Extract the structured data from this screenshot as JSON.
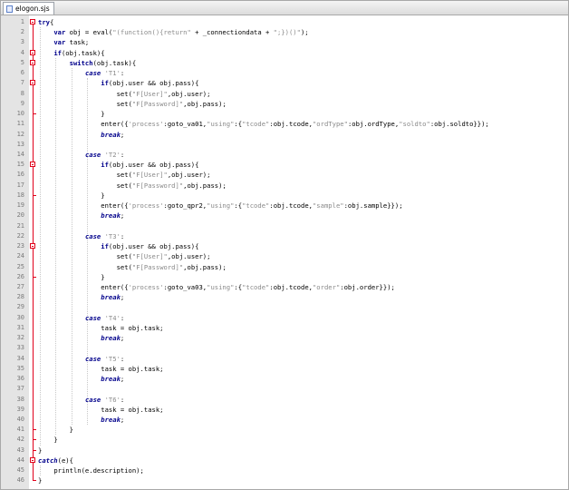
{
  "tab": {
    "title": "elogon.sjs",
    "icon": "document-icon"
  },
  "colors": {
    "fold_marker": "#e0001a",
    "keyword": "#00008b",
    "string": "#8a8a8a",
    "gutter_bg": "#e4e4e4",
    "line_number": "#7a7a7a"
  },
  "code_lines": [
    {
      "n": "1",
      "indent": 0,
      "fold": "start",
      "tokens": [
        {
          "t": "try",
          "c": "kw"
        },
        {
          "t": "{",
          "c": "txt"
        }
      ]
    },
    {
      "n": "2",
      "indent": 2,
      "fold": "",
      "tokens": [
        {
          "t": "var",
          "c": "kw"
        },
        {
          "t": " obj = eval(",
          "c": "txt"
        },
        {
          "t": "\"(function(){return\"",
          "c": "str"
        },
        {
          "t": " + _connectiondata + ",
          "c": "txt"
        },
        {
          "t": "\";})()\"",
          "c": "str"
        },
        {
          "t": ");",
          "c": "txt"
        }
      ]
    },
    {
      "n": "3",
      "indent": 2,
      "fold": "",
      "tokens": [
        {
          "t": "var",
          "c": "kw"
        },
        {
          "t": " task;",
          "c": "txt"
        }
      ]
    },
    {
      "n": "4",
      "indent": 2,
      "fold": "start",
      "tokens": [
        {
          "t": "if",
          "c": "kw"
        },
        {
          "t": "(obj.task){",
          "c": "txt"
        }
      ]
    },
    {
      "n": "5",
      "indent": 4,
      "fold": "start",
      "tokens": [
        {
          "t": "switch",
          "c": "kw"
        },
        {
          "t": "(obj.task){",
          "c": "txt"
        }
      ]
    },
    {
      "n": "6",
      "indent": 6,
      "fold": "",
      "tokens": [
        {
          "t": "case",
          "c": "kwi"
        },
        {
          "t": " ",
          "c": "txt"
        },
        {
          "t": "'T1'",
          "c": "str"
        },
        {
          "t": ":",
          "c": "txt"
        }
      ]
    },
    {
      "n": "7",
      "indent": 8,
      "fold": "start",
      "tokens": [
        {
          "t": "if",
          "c": "kw"
        },
        {
          "t": "(obj.user && obj.pass){",
          "c": "txt"
        }
      ]
    },
    {
      "n": "8",
      "indent": 10,
      "fold": "",
      "tokens": [
        {
          "t": "set(",
          "c": "txt"
        },
        {
          "t": "\"F[User]\"",
          "c": "str"
        },
        {
          "t": ",obj.user);",
          "c": "txt"
        }
      ]
    },
    {
      "n": "9",
      "indent": 10,
      "fold": "",
      "tokens": [
        {
          "t": "set(",
          "c": "txt"
        },
        {
          "t": "\"F[Password]\"",
          "c": "str"
        },
        {
          "t": ",obj.pass);",
          "c": "txt"
        }
      ]
    },
    {
      "n": "10",
      "indent": 8,
      "fold": "end",
      "tokens": [
        {
          "t": "}",
          "c": "txt"
        }
      ]
    },
    {
      "n": "11",
      "indent": 8,
      "fold": "",
      "tokens": [
        {
          "t": "enter({",
          "c": "txt"
        },
        {
          "t": "'process'",
          "c": "str"
        },
        {
          "t": ":goto_va01,",
          "c": "txt"
        },
        {
          "t": "\"using\"",
          "c": "str"
        },
        {
          "t": ":{",
          "c": "txt"
        },
        {
          "t": "\"tcode\"",
          "c": "str"
        },
        {
          "t": ":obj.tcode,",
          "c": "txt"
        },
        {
          "t": "\"ordType\"",
          "c": "str"
        },
        {
          "t": ":obj.ordType,",
          "c": "txt"
        },
        {
          "t": "\"soldto\"",
          "c": "str"
        },
        {
          "t": ":obj.soldto}});",
          "c": "txt"
        }
      ]
    },
    {
      "n": "12",
      "indent": 8,
      "fold": "",
      "tokens": [
        {
          "t": "break",
          "c": "kwi"
        },
        {
          "t": ";",
          "c": "txt"
        }
      ]
    },
    {
      "n": "13",
      "indent": 0,
      "fold": "",
      "tokens": []
    },
    {
      "n": "14",
      "indent": 6,
      "fold": "",
      "tokens": [
        {
          "t": "case",
          "c": "kwi"
        },
        {
          "t": " ",
          "c": "txt"
        },
        {
          "t": "'T2'",
          "c": "str"
        },
        {
          "t": ":",
          "c": "txt"
        }
      ]
    },
    {
      "n": "15",
      "indent": 8,
      "fold": "start",
      "tokens": [
        {
          "t": "if",
          "c": "kw"
        },
        {
          "t": "(obj.user && obj.pass){",
          "c": "txt"
        }
      ]
    },
    {
      "n": "16",
      "indent": 10,
      "fold": "",
      "tokens": [
        {
          "t": "set(",
          "c": "txt"
        },
        {
          "t": "\"F[User]\"",
          "c": "str"
        },
        {
          "t": ",obj.user);",
          "c": "txt"
        }
      ]
    },
    {
      "n": "17",
      "indent": 10,
      "fold": "",
      "tokens": [
        {
          "t": "set(",
          "c": "txt"
        },
        {
          "t": "\"F[Password]\"",
          "c": "str"
        },
        {
          "t": ",obj.pass);",
          "c": "txt"
        }
      ]
    },
    {
      "n": "18",
      "indent": 8,
      "fold": "end",
      "tokens": [
        {
          "t": "}",
          "c": "txt"
        }
      ]
    },
    {
      "n": "19",
      "indent": 8,
      "fold": "",
      "tokens": [
        {
          "t": "enter({",
          "c": "txt"
        },
        {
          "t": "'process'",
          "c": "str"
        },
        {
          "t": ":goto_qpr2,",
          "c": "txt"
        },
        {
          "t": "\"using\"",
          "c": "str"
        },
        {
          "t": ":{",
          "c": "txt"
        },
        {
          "t": "\"tcode\"",
          "c": "str"
        },
        {
          "t": ":obj.tcode,",
          "c": "txt"
        },
        {
          "t": "\"sample\"",
          "c": "str"
        },
        {
          "t": ":obj.sample}});",
          "c": "txt"
        }
      ]
    },
    {
      "n": "20",
      "indent": 8,
      "fold": "",
      "tokens": [
        {
          "t": "break",
          "c": "kwi"
        },
        {
          "t": ";",
          "c": "txt"
        }
      ]
    },
    {
      "n": "21",
      "indent": 0,
      "fold": "",
      "tokens": []
    },
    {
      "n": "22",
      "indent": 6,
      "fold": "",
      "tokens": [
        {
          "t": "case",
          "c": "kwi"
        },
        {
          "t": " ",
          "c": "txt"
        },
        {
          "t": "'T3'",
          "c": "str"
        },
        {
          "t": ":",
          "c": "txt"
        }
      ]
    },
    {
      "n": "23",
      "indent": 8,
      "fold": "start",
      "tokens": [
        {
          "t": "if",
          "c": "kw"
        },
        {
          "t": "(obj.user && obj.pass){",
          "c": "txt"
        }
      ]
    },
    {
      "n": "24",
      "indent": 10,
      "fold": "",
      "tokens": [
        {
          "t": "set(",
          "c": "txt"
        },
        {
          "t": "\"F[User]\"",
          "c": "str"
        },
        {
          "t": ",obj.user);",
          "c": "txt"
        }
      ]
    },
    {
      "n": "25",
      "indent": 10,
      "fold": "",
      "tokens": [
        {
          "t": "set(",
          "c": "txt"
        },
        {
          "t": "\"F[Password]\"",
          "c": "str"
        },
        {
          "t": ",obj.pass);",
          "c": "txt"
        }
      ]
    },
    {
      "n": "26",
      "indent": 8,
      "fold": "end",
      "tokens": [
        {
          "t": "}",
          "c": "txt"
        }
      ]
    },
    {
      "n": "27",
      "indent": 8,
      "fold": "",
      "tokens": [
        {
          "t": "enter({",
          "c": "txt"
        },
        {
          "t": "'process'",
          "c": "str"
        },
        {
          "t": ":goto_va03,",
          "c": "txt"
        },
        {
          "t": "\"using\"",
          "c": "str"
        },
        {
          "t": ":{",
          "c": "txt"
        },
        {
          "t": "\"tcode\"",
          "c": "str"
        },
        {
          "t": ":obj.tcode,",
          "c": "txt"
        },
        {
          "t": "\"order\"",
          "c": "str"
        },
        {
          "t": ":obj.order}});",
          "c": "txt"
        }
      ]
    },
    {
      "n": "28",
      "indent": 8,
      "fold": "",
      "tokens": [
        {
          "t": "break",
          "c": "kwi"
        },
        {
          "t": ";",
          "c": "txt"
        }
      ]
    },
    {
      "n": "29",
      "indent": 0,
      "fold": "",
      "tokens": []
    },
    {
      "n": "30",
      "indent": 6,
      "fold": "",
      "tokens": [
        {
          "t": "case",
          "c": "kwi"
        },
        {
          "t": " ",
          "c": "txt"
        },
        {
          "t": "'T4'",
          "c": "str"
        },
        {
          "t": ":",
          "c": "txt"
        }
      ]
    },
    {
      "n": "31",
      "indent": 8,
      "fold": "",
      "tokens": [
        {
          "t": "task = obj.task;",
          "c": "txt"
        }
      ]
    },
    {
      "n": "32",
      "indent": 8,
      "fold": "",
      "tokens": [
        {
          "t": "break",
          "c": "kwi"
        },
        {
          "t": ";",
          "c": "txt"
        }
      ]
    },
    {
      "n": "33",
      "indent": 0,
      "fold": "",
      "tokens": []
    },
    {
      "n": "34",
      "indent": 6,
      "fold": "",
      "tokens": [
        {
          "t": "case",
          "c": "kwi"
        },
        {
          "t": " ",
          "c": "txt"
        },
        {
          "t": "'T5'",
          "c": "str"
        },
        {
          "t": ":",
          "c": "txt"
        }
      ]
    },
    {
      "n": "35",
      "indent": 8,
      "fold": "",
      "tokens": [
        {
          "t": "task = obj.task;",
          "c": "txt"
        }
      ]
    },
    {
      "n": "36",
      "indent": 8,
      "fold": "",
      "tokens": [
        {
          "t": "break",
          "c": "kwi"
        },
        {
          "t": ";",
          "c": "txt"
        }
      ]
    },
    {
      "n": "37",
      "indent": 0,
      "fold": "",
      "tokens": []
    },
    {
      "n": "38",
      "indent": 6,
      "fold": "",
      "tokens": [
        {
          "t": "case",
          "c": "kwi"
        },
        {
          "t": " ",
          "c": "txt"
        },
        {
          "t": "'T6'",
          "c": "str"
        },
        {
          "t": ":",
          "c": "txt"
        }
      ]
    },
    {
      "n": "39",
      "indent": 8,
      "fold": "",
      "tokens": [
        {
          "t": "task = obj.task;",
          "c": "txt"
        }
      ]
    },
    {
      "n": "40",
      "indent": 8,
      "fold": "",
      "tokens": [
        {
          "t": "break",
          "c": "kwi"
        },
        {
          "t": ";",
          "c": "txt"
        }
      ]
    },
    {
      "n": "41",
      "indent": 4,
      "fold": "end",
      "tokens": [
        {
          "t": "}",
          "c": "txt"
        }
      ]
    },
    {
      "n": "42",
      "indent": 2,
      "fold": "end",
      "tokens": [
        {
          "t": "}",
          "c": "txt"
        }
      ]
    },
    {
      "n": "43",
      "indent": 0,
      "fold": "end",
      "tokens": [
        {
          "t": "}",
          "c": "txt"
        }
      ]
    },
    {
      "n": "44",
      "indent": 0,
      "fold": "start",
      "tokens": [
        {
          "t": "catch",
          "c": "kwi"
        },
        {
          "t": "(e){",
          "c": "txt"
        }
      ]
    },
    {
      "n": "45",
      "indent": 2,
      "fold": "",
      "tokens": [
        {
          "t": "println(e.description);",
          "c": "txt"
        }
      ]
    },
    {
      "n": "46",
      "indent": 0,
      "fold": "end",
      "tokens": [
        {
          "t": "}",
          "c": "txt"
        }
      ]
    }
  ]
}
